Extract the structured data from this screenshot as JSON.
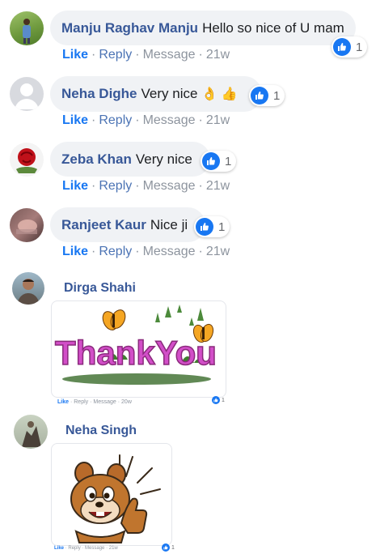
{
  "actions": {
    "like": "Like",
    "reply": "Reply",
    "message": "Message"
  },
  "comments": [
    {
      "author": "Manju Raghav Manju",
      "text": "Hello so nice of U mam",
      "reactions": "1",
      "time": "21w"
    },
    {
      "author": "Neha Dighe",
      "text": "Very nice",
      "emoji": "👌 👍",
      "reactions": "1",
      "time": "21w"
    },
    {
      "author": "Zeba Khan",
      "text": "Very nice",
      "reactions": "1",
      "time": "21w"
    },
    {
      "author": "Ranjeet Kaur",
      "text": "Nice ji",
      "reactions": "1",
      "time": "21w"
    }
  ],
  "sticker_comments": [
    {
      "author": "Dirga Shahi",
      "sticker_text": "ThankYou",
      "time": "20w",
      "reactions": "1"
    },
    {
      "author": "Neha Singh",
      "time": "21w",
      "reactions": "1"
    }
  ],
  "colors": {
    "author": "#385898",
    "like": "#1877f2",
    "bubble": "#f0f2f5",
    "meta": "#8d949e"
  },
  "icons": {
    "reaction": "thumbs-up-icon"
  }
}
